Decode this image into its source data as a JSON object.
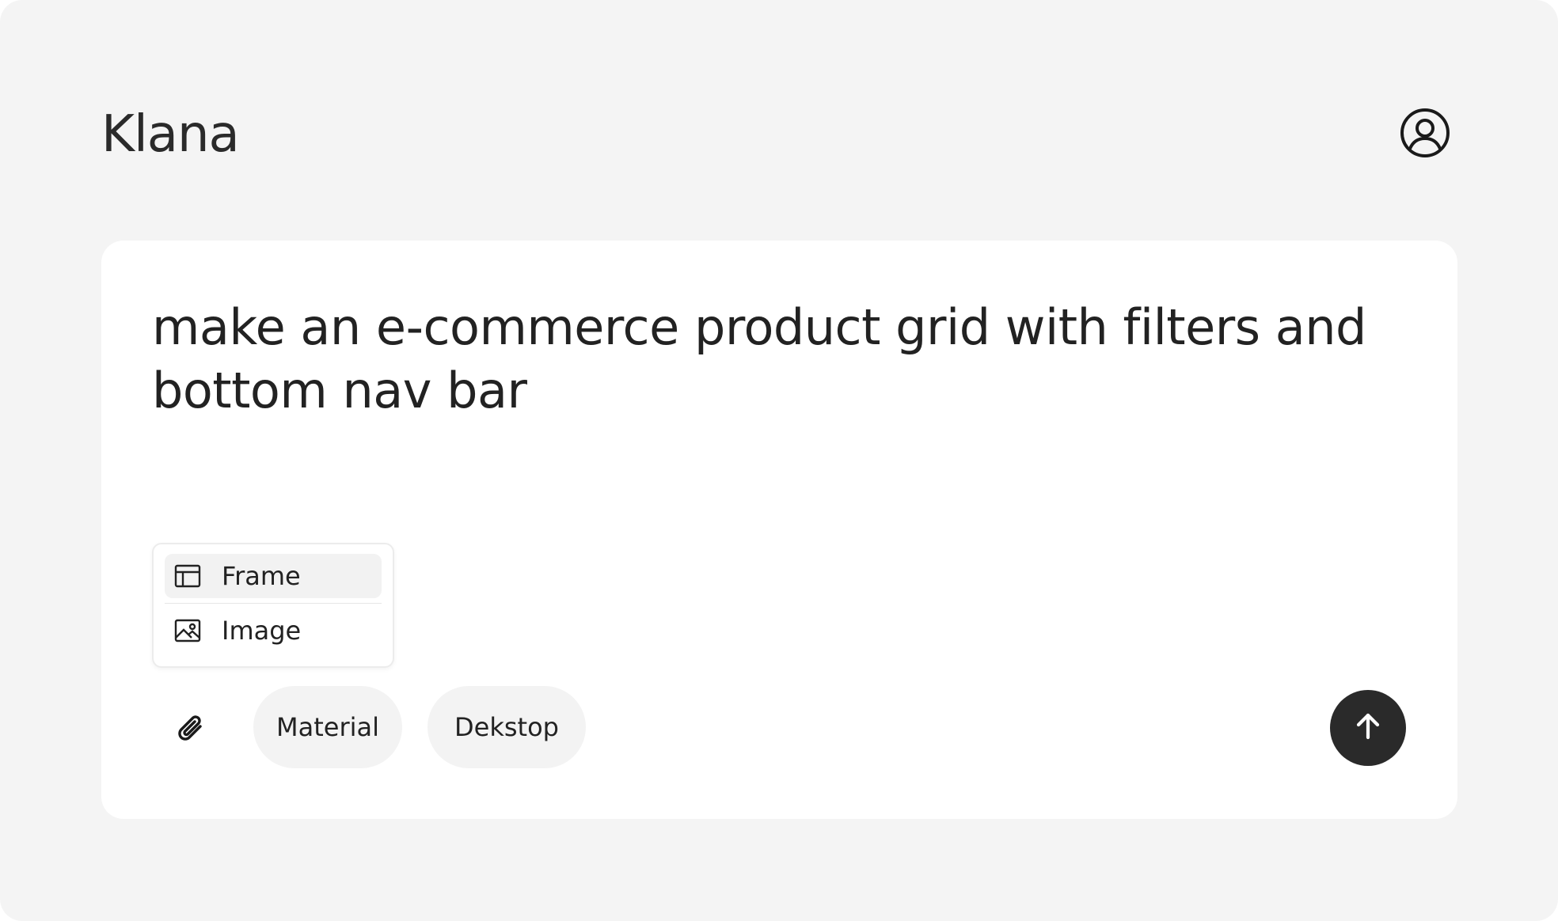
{
  "header": {
    "brand": "Klana",
    "profile_icon": "user-circle-icon"
  },
  "composer": {
    "prompt_text": "make an e-commerce product grid with filters and bottom nav bar",
    "attach_menu": {
      "items": [
        {
          "label": "Frame",
          "icon": "frame-icon",
          "active": true
        },
        {
          "label": "Image",
          "icon": "image-icon",
          "active": false
        }
      ]
    },
    "toolbar": {
      "attach_icon": "paperclip-icon",
      "chips": [
        {
          "label": "Material"
        },
        {
          "label": "Dekstop"
        }
      ],
      "send_icon": "arrow-up-icon"
    }
  },
  "colors": {
    "page_bg": "#f4f4f4",
    "card_bg": "#ffffff",
    "chip_bg": "#f3f3f3",
    "send_bg": "#2a2a2a",
    "text": "#222222"
  }
}
